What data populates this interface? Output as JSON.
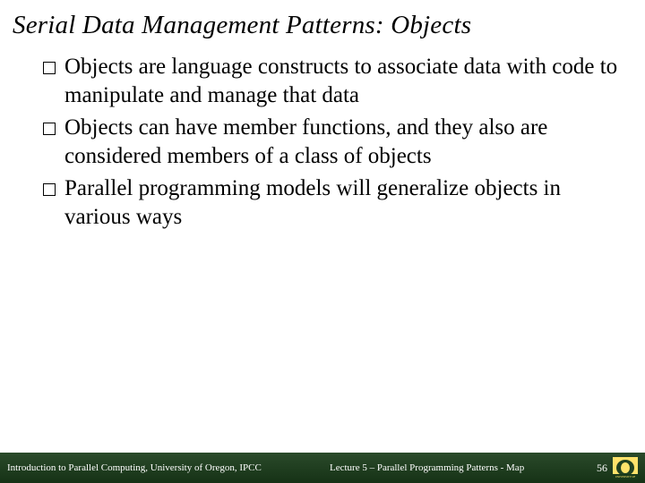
{
  "title": "Serial Data Management Patterns: Objects",
  "bullets": [
    {
      "text": "Objects are language constructs to associate data with code to manipulate and manage that data"
    },
    {
      "text": "Objects can have member functions, and they also are considered members of a class of objects"
    },
    {
      "text": "Parallel programming models will generalize objects in various ways"
    }
  ],
  "footer": {
    "left": "Introduction to Parallel Computing, University of Oregon, IPCC",
    "center": "Lecture 5 – Parallel Programming Patterns - Map",
    "page": "56",
    "logo_label": "UNIVERSITY OF OREGON"
  }
}
